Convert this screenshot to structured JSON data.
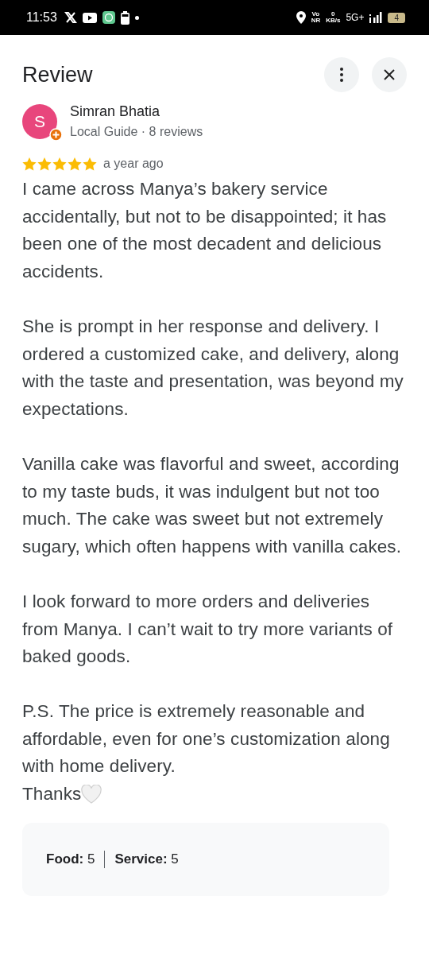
{
  "status_bar": {
    "time": "11:53",
    "volte": [
      "Vo",
      "NR"
    ],
    "speed": [
      "0",
      "KB/s"
    ],
    "network": "5G+",
    "battery": "4"
  },
  "header": {
    "title": "Review"
  },
  "reviewer": {
    "initial": "S",
    "name": "Simran Bhatia",
    "subtitle": "Local Guide · 8 reviews"
  },
  "review": {
    "stars": 5,
    "time": "a year ago",
    "paragraphs": [
      "I came across Manya’s bakery service accidentally, but not to be disappointed; it has been one of the most decadent and delicious accidents.",
      "She is prompt in her response and delivery. I ordered a customized cake, and delivery, along with the taste and presentation, was beyond my expectations.",
      "Vanilla cake was flavorful and sweet, according to my taste buds, it was indulgent but not too much. The cake was sweet but not extremely sugary, which often happens with vanilla cakes.",
      "I look forward to more orders and deliveries from Manya. I can’t wait to try more variants of baked goods.",
      "P.S. The price is extremely reasonable and affordable, even for one’s customization along with home delivery."
    ],
    "closing": "Thanks"
  },
  "ratings": [
    {
      "label": "Food:",
      "value": "5"
    },
    {
      "label": "Service:",
      "value": "5"
    }
  ]
}
